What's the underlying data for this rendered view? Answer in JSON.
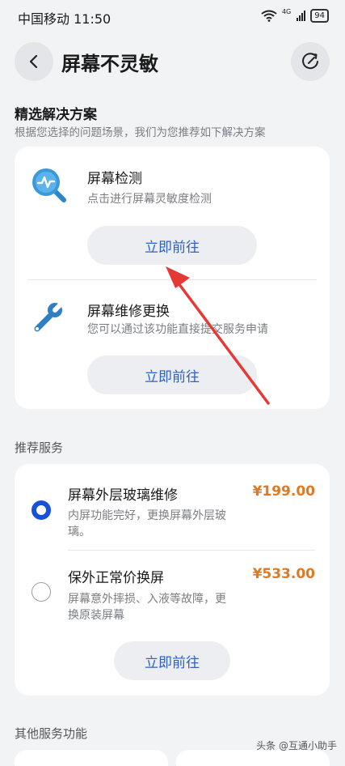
{
  "status_bar": {
    "carrier_time": "中国移动 11:50",
    "network": "4G",
    "battery": "94"
  },
  "header": {
    "title": "屏幕不灵敏",
    "back_icon": "chevron-left-icon",
    "refresh_icon": "refresh-icon"
  },
  "solutions": {
    "title": "精选解决方案",
    "subtitle": "根据您选择的问题场景，我们为您推荐如下解决方案",
    "items": [
      {
        "title": "屏幕检测",
        "desc": "点击进行屏幕灵敏度检测",
        "button": "立即前往",
        "icon": "screen-check-icon"
      },
      {
        "title": "屏幕维修更换",
        "desc": "您可以通过该功能直接提交服务申请",
        "button": "立即前往",
        "icon": "wrench-icon"
      }
    ]
  },
  "services": {
    "title": "推荐服务",
    "items": [
      {
        "title": "屏幕外层玻璃维修",
        "price": "¥199.00",
        "desc_line1": "内屏功能完好，更换屏幕外层玻",
        "desc_line2": "璃。",
        "selected": true
      },
      {
        "title": "保外正常价换屏",
        "price": "¥533.00",
        "desc_line1": "屏幕意外摔损、入液等故障，更",
        "desc_line2": "换原装屏幕",
        "selected": false
      }
    ],
    "button": "立即前往"
  },
  "other": {
    "title": "其他服务功能"
  },
  "watermark": "头条 @互通小助手",
  "colors": {
    "accent_blue": "#2e62c5",
    "radio_blue": "#1552d9",
    "price_orange": "#e07a22",
    "annotation_arrow": "#e53935"
  }
}
